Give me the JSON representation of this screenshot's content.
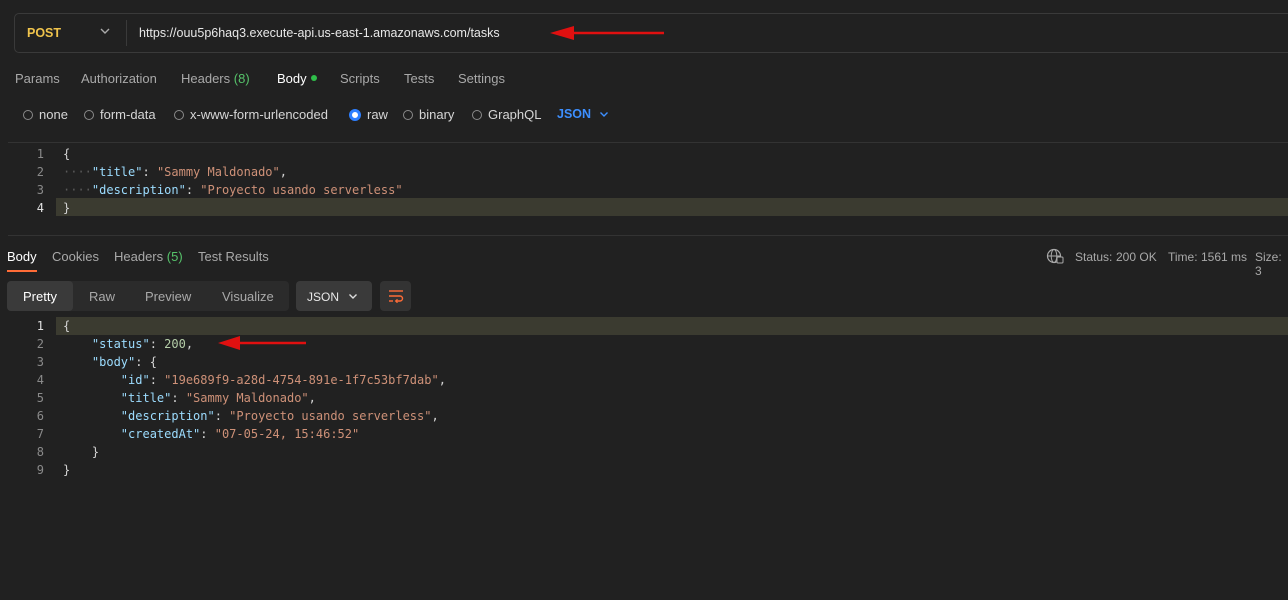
{
  "request": {
    "method": "POST",
    "url": "https://ouu5p6haq3.execute-api.us-east-1.amazonaws.com/tasks"
  },
  "request_tabs": [
    {
      "label": "Params"
    },
    {
      "label": "Authorization"
    },
    {
      "label": "Headers",
      "count": "(8)"
    },
    {
      "label": "Body"
    },
    {
      "label": "Scripts"
    },
    {
      "label": "Tests"
    },
    {
      "label": "Settings"
    }
  ],
  "body_types": [
    "none",
    "form-data",
    "x-www-form-urlencoded",
    "raw",
    "binary",
    "GraphQL"
  ],
  "body_format": "JSON",
  "request_body": {
    "line_numbers": [
      "1",
      "2",
      "3",
      "4"
    ],
    "title_key": "\"title\"",
    "title_value": "\"Sammy Maldonado\"",
    "description_key": "\"description\"",
    "description_value": "\"Proyecto usando serverless\""
  },
  "response_tabs": [
    {
      "label": "Body"
    },
    {
      "label": "Cookies"
    },
    {
      "label": "Headers",
      "count": "(5)"
    },
    {
      "label": "Test Results"
    }
  ],
  "response_meta": {
    "status_label": "Status:",
    "status_value": "200 OK",
    "time_label": "Time:",
    "time_value": "1561 ms",
    "size_label": "Size: 3"
  },
  "view_modes": [
    "Pretty",
    "Raw",
    "Preview",
    "Visualize"
  ],
  "response_format": "JSON",
  "response_body": {
    "line_numbers": [
      "1",
      "2",
      "3",
      "4",
      "5",
      "6",
      "7",
      "8",
      "9"
    ],
    "status_key": "\"status\"",
    "status_value": "200",
    "body_key": "\"body\"",
    "id_key": "\"id\"",
    "id_value": "\"19e689f9-a28d-4754-891e-1f7c53bf7dab\"",
    "title_key": "\"title\"",
    "title_value": "\"Sammy Maldonado\"",
    "description_key": "\"description\"",
    "description_value": "\"Proyecto usando serverless\"",
    "created_key": "\"createdAt\"",
    "created_value": "\"07-05-24, 15:46:52\""
  },
  "colors": {
    "method": "#f0c44c",
    "accent": "#ff6c37",
    "status_ok": "#56c26a",
    "arrow": "#e01010",
    "link_blue": "#3d8fff"
  }
}
